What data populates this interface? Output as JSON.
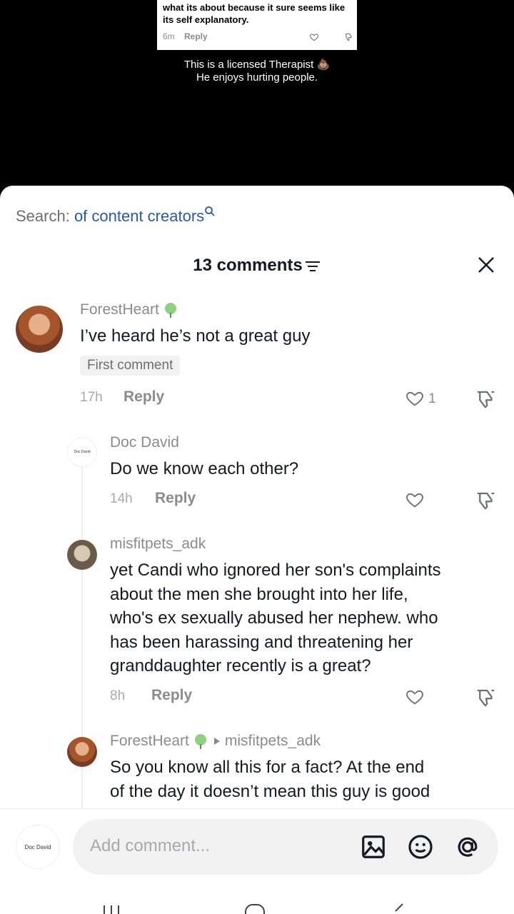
{
  "video": {
    "quoted_comment": {
      "text": "what its about because it sure seems like its self explanatory.",
      "time": "6m",
      "reply": "Reply"
    },
    "caption_line1": "This is a licensed Therapist 💩",
    "caption_line2": "He enjoys hurting people."
  },
  "search": {
    "label": "Search: ",
    "query": "of content creators",
    "icon": "search-icon"
  },
  "header": {
    "count_label": "13 comments",
    "filter_icon": "filter-icon",
    "close_icon": "close-icon"
  },
  "comments": [
    {
      "username": "ForestHeart",
      "text": "I’ve heard he’s not a great guy",
      "badge": "First comment",
      "time": "17h",
      "reply": "Reply",
      "likes": "1"
    },
    {
      "username": "Doc David",
      "avatar_text": "Doc David",
      "text": "Do we know each other?",
      "time": "14h",
      "reply": "Reply"
    },
    {
      "username": "misfitpets_adk",
      "text_lines": [
        "yet Candi who ignored her son's complaints",
        "about the men she brought into her life,",
        "who's ex sexually abused her nephew. who",
        "has been harassing and threatening her",
        "granddaughter recently is a great?"
      ],
      "time": "8h",
      "reply": "Reply"
    },
    {
      "username": "ForestHeart",
      "reply_to": "misfitpets_adk",
      "text_lines": [
        "So you know all this for a fact? At the end",
        "of the day it doesn’t mean this guy is good"
      ]
    }
  ],
  "composer": {
    "avatar_text": "Doc David",
    "placeholder": "Add comment...",
    "icons": [
      "image-icon",
      "emoji-icon",
      "mention-icon"
    ]
  },
  "colors": {
    "accent_link": "#2c5aa0",
    "muted": "#8a8b91",
    "text": "#161823"
  }
}
